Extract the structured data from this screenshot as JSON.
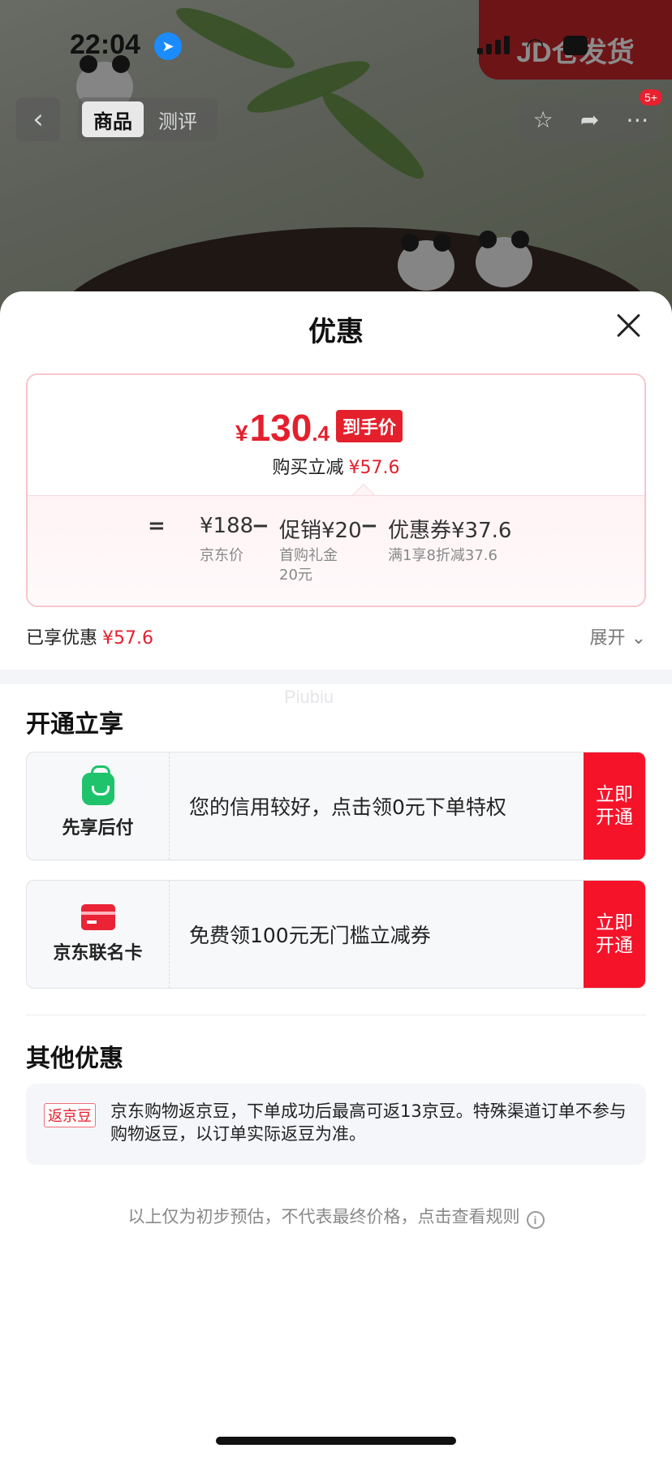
{
  "status_bar": {
    "time": "22:04"
  },
  "product_page": {
    "tabs": [
      {
        "label": "商品",
        "active": true
      },
      {
        "label": "测评",
        "active": false
      }
    ],
    "message_badge": "5+",
    "shipping_badge": "JD仓发货"
  },
  "sheet": {
    "title": "优惠",
    "final_price": {
      "currency": "¥",
      "integer": "130",
      "decimal": ".4",
      "tag": "到手价"
    },
    "reduction": {
      "label": "购买立减",
      "amount": "¥57.6"
    },
    "formula": {
      "equals": "=",
      "terms": [
        {
          "value": "¥188",
          "sub": "京东价"
        },
        {
          "operator": "−",
          "value": "促销¥20",
          "sub_lines": [
            "首购礼金",
            "20元"
          ]
        },
        {
          "operator": "−",
          "value": "优惠券¥37.6",
          "sub": "满1享8折减37.6"
        }
      ]
    },
    "enjoyed": {
      "label": "已享优惠",
      "amount": "¥57.6",
      "expand_label": "展开"
    },
    "watermark": "Piubiu",
    "open_section": {
      "title": "开通立享",
      "offers": [
        {
          "icon": "shopping-bag-icon",
          "name": "先享后付",
          "text": "您的信用较好，点击领0元下单特权",
          "cta": "立即开通"
        },
        {
          "icon": "credit-card-icon",
          "name": "京东联名卡",
          "text": "免费领100元无门槛立减券",
          "cta": "立即开通"
        }
      ]
    },
    "other_section": {
      "title": "其他优惠",
      "bean_tag": "返京豆",
      "bean_text": "京东购物返京豆，下单成功后最高可返13京豆。特殊渠道订单不参与购物返豆，以订单实际返豆为准。"
    },
    "footer_note": "以上仅为初步预估，不代表最终价格，点击查看规则",
    "accent_color": "#e4202d",
    "cta_color": "#f5132a"
  }
}
